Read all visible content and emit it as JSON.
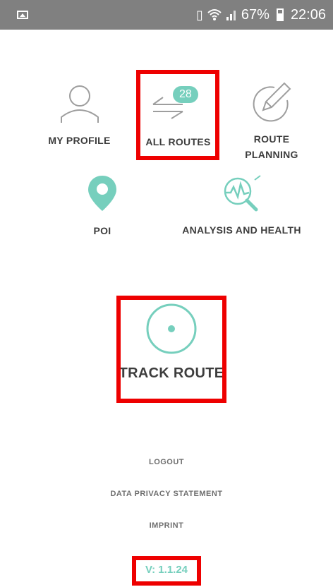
{
  "status_bar": {
    "battery": "67%",
    "time": "22:06",
    "icons": [
      "image-icon",
      "vibrate-icon",
      "wifi-icon",
      "signal-icon",
      "battery-icon"
    ]
  },
  "menu": {
    "my_profile": {
      "label": "MY PROFILE",
      "icon": "user-icon"
    },
    "all_routes": {
      "label": "ALL ROUTES",
      "icon": "routes-icon",
      "badge": "28"
    },
    "route_planning": {
      "label_line1": "ROUTE",
      "label_line2": "PLANNING",
      "icon": "edit-pencil-icon"
    },
    "poi": {
      "label": "POI",
      "icon": "map-pin-icon"
    },
    "analysis_health": {
      "label": "ANALYSIS AND HEALTH",
      "icon": "analysis-icon"
    }
  },
  "track": {
    "label": "TRACK ROUTE",
    "icon": "record-icon"
  },
  "footer": {
    "logout": "LOGOUT",
    "privacy": "DATA PRIVACY STATEMENT",
    "imprint": "IMPRINT",
    "version": "V: 1.1.24"
  },
  "colors": {
    "accent": "#76cfbd",
    "icon_gray": "#9e9e9e",
    "text": "#3d3d3d",
    "highlight": "#ee0000",
    "status_bar": "#808080"
  }
}
